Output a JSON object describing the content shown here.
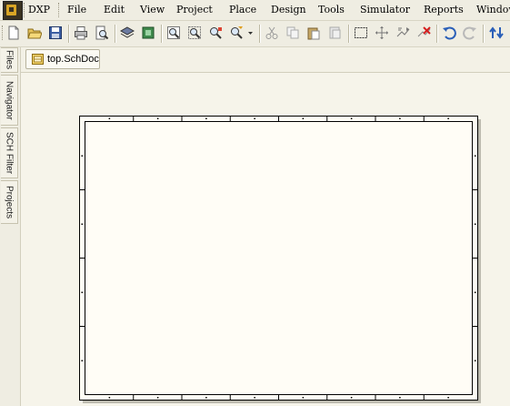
{
  "menubar": {
    "items": [
      "DXP",
      "File",
      "Edit",
      "View",
      "Project",
      "Place",
      "Design",
      "Tools",
      "Simulator",
      "Reports",
      "Window"
    ]
  },
  "toolbar": {
    "buttons": [
      "new-document-icon",
      "open-folder-icon",
      "save-icon",
      "print-icon",
      "print-preview-icon",
      "layers-icon",
      "chip-library-icon",
      "zoom-fit-document-icon",
      "zoom-area-icon",
      "zoom-selected-icon",
      "zoom-filter-icon",
      "dropdown-arrow-icon",
      "cut-icon",
      "copy-icon",
      "paste-icon",
      "rubber-stamp-icon",
      "select-rectangle-icon",
      "move-cross-icon",
      "move-selection-icon",
      "clear-selection-icon",
      "undo-icon",
      "redo-icon",
      "up-down-hierarchy-icon"
    ]
  },
  "sidepanel": {
    "tabs": [
      "Files",
      "Navigator",
      "SCH Filter",
      "Projects"
    ]
  },
  "document": {
    "tab_label": "top.SchDoc"
  },
  "colors": {
    "sheet_fill": "#fffdf6",
    "sheet_border": "#000000",
    "workspace": "#f6f4ea",
    "chrome": "#efede2"
  }
}
